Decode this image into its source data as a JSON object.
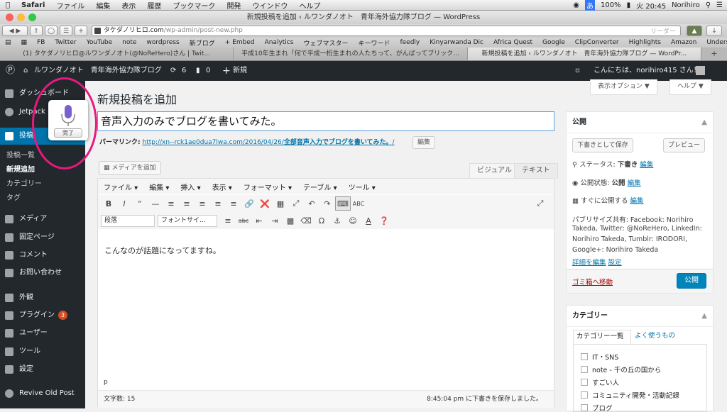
{
  "mac_menubar": {
    "items": [
      "Safari",
      "ファイル",
      "編集",
      "表示",
      "履歴",
      "ブックマーク",
      "開発",
      "ウインドウ",
      "ヘルプ"
    ],
    "battery": "100%",
    "clock": "火 20:45",
    "user": "Norihiro",
    "ime": "あ"
  },
  "window": {
    "title": "新規投稿を追加 ‹ ルワンダノオト　青年海外協力隊ブログ — WordPress"
  },
  "address_bar": {
    "site": "タケダノリヒロ.com",
    "path": "/wp-admin/post-new.php",
    "reader": "リーダー"
  },
  "bookmarks": [
    "FB",
    "Twitter",
    "YouTube",
    "note",
    "wordpress",
    "新ブログ",
    "+ Embed",
    "Analytics",
    "ウェブマスター",
    "キーワード",
    "feedly",
    "Kinyarwanda Dic",
    "Africa Quest",
    "Google",
    "ClipConverter",
    "Highlights",
    "Amazon",
    "Undersky"
  ],
  "tabs": [
    {
      "label": "(1) タケダノリヒロ@ルワンダノオト(@NoReHero)さん | Twit..."
    },
    {
      "label": "平成10年生まれ「何で平成一桁生まれの人たちって、がんばってブリック..."
    },
    {
      "label": "新規投稿を追加 ‹ ルワンダノオト　青年海外協力隊ブログ — WordPr..."
    }
  ],
  "admin_bar": {
    "site_name": "ルワンダノオト　青年海外協力隊ブログ",
    "updates": "6",
    "comments": "0",
    "new_label": "新規",
    "greeting": "こんにちは、norihiro415 さん！"
  },
  "sidebar": {
    "items": [
      {
        "label": "ダッシュボード",
        "icon": "dashboard-icon"
      },
      {
        "label": "Jetpack",
        "icon": "jetpack-icon"
      },
      {
        "label": "投稿",
        "icon": "pin-icon"
      },
      {
        "label": "メディア",
        "icon": "media-icon"
      },
      {
        "label": "固定ページ",
        "icon": "page-icon"
      },
      {
        "label": "コメント",
        "icon": "comment-icon"
      },
      {
        "label": "お問い合わせ",
        "icon": "mail-icon"
      },
      {
        "label": "外観",
        "icon": "brush-icon"
      },
      {
        "label": "プラグイン",
        "icon": "plugin-icon",
        "badge": "3"
      },
      {
        "label": "ユーザー",
        "icon": "user-icon"
      },
      {
        "label": "ツール",
        "icon": "wrench-icon"
      },
      {
        "label": "設定",
        "icon": "settings-icon"
      },
      {
        "label": "Revive Old Post",
        "icon": "revive-icon"
      }
    ],
    "subitems": [
      "投稿一覧",
      "新規追加",
      "カテゴリー",
      "タグ"
    ]
  },
  "page": {
    "title": "新規投稿を追加",
    "screen_options": "表示オプション ▼",
    "help": "ヘルプ ▼",
    "post_title": "音声入力のみでブログを書いてみた。",
    "permalink_label": "パーマリンク:",
    "permalink_url": "http://xn--rck1ae0dua7lwa.com/2016/04/26/",
    "permalink_slug": "全部音声入力でブログを書いてみた。",
    "permalink_tail": "/",
    "edit_label": "編集",
    "add_media": "メディアを追加",
    "tab_visual": "ビジュアル",
    "tab_text": "テキスト"
  },
  "editor": {
    "menu": [
      "ファイル ▾",
      "編集 ▾",
      "挿入 ▾",
      "表示 ▾",
      "フォーマット ▾",
      "テーブル ▾",
      "ツール ▾"
    ],
    "format_select": "段落",
    "font_select": "フォントサイ...",
    "content": "こんなのが話題になってますね。",
    "path": "p",
    "word_count": "文字数: 15",
    "saved": "8:45:04 pm に下書きを保存しました。"
  },
  "publish_box": {
    "title": "公開",
    "save_draft": "下書きとして保存",
    "preview": "プレビュー",
    "status_label": "ステータス:",
    "status_value": "下書き",
    "visibility_label": "公開状態:",
    "visibility_value": "公開",
    "schedule": "すぐに公開する",
    "edit": "編集",
    "share_line1": "パブリサイズ共有: Facebook: Norihiro",
    "share_line2": "Takeda, Twitter: @NoReHero, LinkedIn:",
    "share_line3": "Norihiro Takeda, Tumblr: IRODORI,",
    "share_line4": "Google+: Norihiro Takeda",
    "details_edit": "詳細を編集",
    "settings": "設定",
    "trash": "ゴミ箱へ移動",
    "publish": "公開"
  },
  "category_box": {
    "title": "カテゴリー",
    "tab_all": "カテゴリー一覧",
    "tab_popular": "よく使うもの",
    "items": [
      "IT・SNS",
      "note - 千の丘の国から",
      "すごい人",
      "コミュニティ開発・活動記録",
      "ブログ"
    ]
  },
  "dictation": {
    "done": "完了"
  },
  "colors": {
    "admin_bg": "#23282d",
    "accent": "#0073aa",
    "highlight": "#e8187e",
    "trash": "#a00"
  }
}
